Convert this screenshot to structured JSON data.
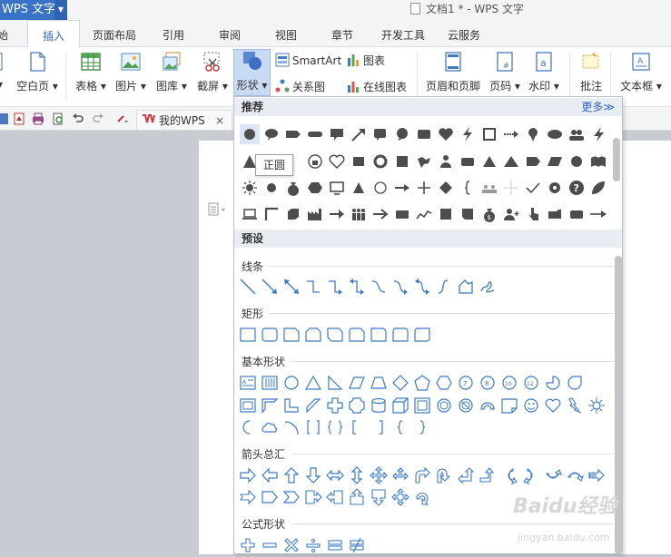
{
  "titlebar": {
    "app_name": "WPS 文字",
    "doc_title": "文档1 * - WPS 文字"
  },
  "tabs": [
    {
      "label": "始"
    },
    {
      "label": "插入",
      "active": true
    },
    {
      "label": "页面布局"
    },
    {
      "label": "引用"
    },
    {
      "label": "审阅"
    },
    {
      "label": "视图"
    },
    {
      "label": "章节"
    },
    {
      "label": "开发工具"
    },
    {
      "label": "云服务"
    }
  ],
  "ribbon": {
    "blank_page": "空白页",
    "table": "表格",
    "picture": "图片",
    "gallery": "图库",
    "screenshot": "截屏",
    "shapes": "形状",
    "smartart": "SmartArt",
    "chart": "图表",
    "relation": "关系图",
    "online_chart": "在线图表",
    "header_footer": "页眉和页脚",
    "page_number": "页码",
    "watermark": "水印",
    "comment": "批注",
    "textbox": "文本框",
    "dropdown": "▾"
  },
  "qat": {
    "my_wps": "我的WPS",
    "close": "×"
  },
  "panel": {
    "recommended": "推荐",
    "more": "更多≫",
    "presets": "预设",
    "tooltip": "正圆",
    "categories": {
      "lines": "线条",
      "rect": "矩形",
      "basic": "基本形状",
      "arrows": "箭头总汇",
      "formula": "公式形状"
    }
  },
  "colors": {
    "accent": "#3a72c8",
    "shape_fill": "#4d4d4d",
    "outline": "#3c7bc7",
    "active_bg": "#c9daf5"
  },
  "watermark": {
    "brand": "Baidu经验",
    "url": "jingyan.baidu.com"
  }
}
